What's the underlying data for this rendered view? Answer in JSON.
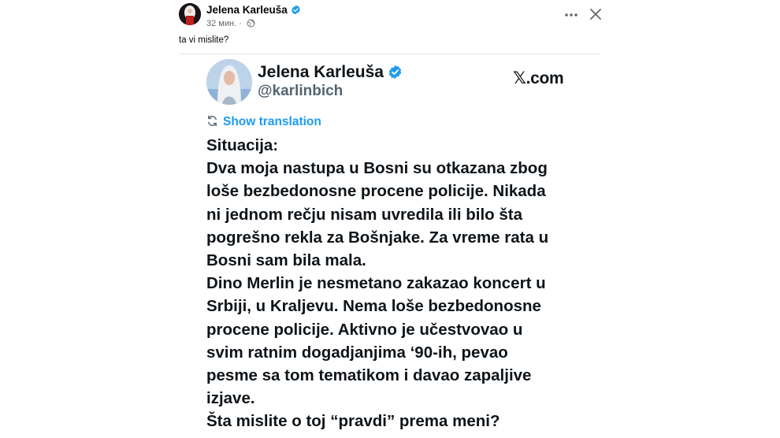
{
  "post": {
    "author_name": "Jelena Karleuša",
    "timestamp": "32 мин.",
    "privacy_icon": "globe-icon",
    "caption": "ta vi mislite?"
  },
  "tweet": {
    "name": "Jelena Karleuša",
    "handle": "@karlinbich",
    "source": "𝕏.com",
    "show_translation": "Show translation",
    "lines": [
      "Situacija:",
      "Dva moja nastupa u Bosni su otkazana zbog",
      "loše bezbedonosne procene policije. Nikada",
      "ni jednom rečju nisam uvredila ili bilo šta",
      "pogrešno rekla za Bošnjake. Za vreme rata u",
      "Bosni sam bila mala.",
      "Dino Merlin je nesmetano zakazao koncert u",
      "Srbiji, u Kraljevu. Nema loše bezbedonosne",
      "procene policije. Aktivno je učestvovao u",
      "svim ratnim dogadjanjima ‘90-ih, pevao",
      "pesme sa tom tematikom i davao zapaljive",
      "izjave.",
      "Šta mislite o toj “pravdi” prema meni?"
    ]
  },
  "colors": {
    "verified": "#1d9bf0",
    "link": "#1d9bf0",
    "meta": "#65676b",
    "divider": "#e4e6eb"
  }
}
